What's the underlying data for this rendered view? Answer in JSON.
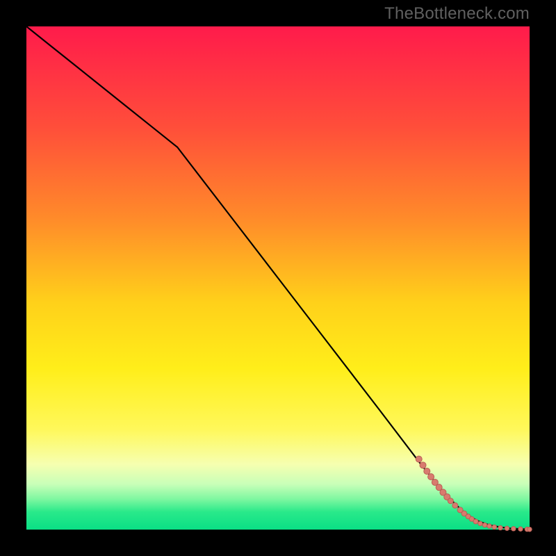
{
  "attribution": "TheBottleneck.com",
  "gradient_stops": [
    {
      "pct": 0,
      "color": "#ff1b4b"
    },
    {
      "pct": 20,
      "color": "#ff4e3a"
    },
    {
      "pct": 38,
      "color": "#ff8a2a"
    },
    {
      "pct": 55,
      "color": "#ffd11a"
    },
    {
      "pct": 68,
      "color": "#ffee1a"
    },
    {
      "pct": 80,
      "color": "#fff85a"
    },
    {
      "pct": 87,
      "color": "#f6ffb0"
    },
    {
      "pct": 91,
      "color": "#c8ffb8"
    },
    {
      "pct": 94,
      "color": "#7cf7a0"
    },
    {
      "pct": 96.5,
      "color": "#29e98a"
    },
    {
      "pct": 100,
      "color": "#0adf85"
    }
  ],
  "styles": {
    "line_color": "#000000",
    "line_width": 2.2,
    "marker_fill": "#d87b6e",
    "marker_stroke": "#ba5f55",
    "marker_stroke_width": 1.0
  },
  "chart_data": {
    "type": "line",
    "title": "",
    "xlabel": "",
    "ylabel": "",
    "xlim": [
      0,
      100
    ],
    "ylim": [
      0,
      100
    ],
    "grid": false,
    "series": [
      {
        "name": "curve",
        "kind": "line",
        "x": [
          0,
          5,
          10,
          15,
          20,
          25,
          30,
          40,
          50,
          60,
          70,
          78,
          82,
          85,
          87,
          88.5,
          90,
          92,
          94,
          96,
          98,
          100
        ],
        "y": [
          100,
          96,
          92,
          88,
          84,
          80,
          76,
          63,
          50,
          37,
          24,
          13.5,
          8.5,
          5.3,
          3.4,
          2.4,
          1.6,
          0.9,
          0.5,
          0.25,
          0.12,
          0.05
        ]
      },
      {
        "name": "markers",
        "kind": "scatter",
        "points": [
          {
            "x": 78.0,
            "y": 14.0,
            "r": 4.5
          },
          {
            "x": 78.8,
            "y": 12.8,
            "r": 4.5
          },
          {
            "x": 79.6,
            "y": 11.6,
            "r": 4.5
          },
          {
            "x": 80.4,
            "y": 10.5,
            "r": 4.5
          },
          {
            "x": 81.2,
            "y": 9.4,
            "r": 4.5
          },
          {
            "x": 82.0,
            "y": 8.4,
            "r": 4.5
          },
          {
            "x": 82.8,
            "y": 7.4,
            "r": 4.5
          },
          {
            "x": 83.6,
            "y": 6.5,
            "r": 4.5
          },
          {
            "x": 84.3,
            "y": 5.7,
            "r": 4.0
          },
          {
            "x": 85.2,
            "y": 4.8,
            "r": 4.0
          },
          {
            "x": 86.2,
            "y": 3.9,
            "r": 4.0
          },
          {
            "x": 87.0,
            "y": 3.2,
            "r": 3.8
          },
          {
            "x": 87.8,
            "y": 2.6,
            "r": 3.5
          },
          {
            "x": 88.5,
            "y": 2.1,
            "r": 3.5
          },
          {
            "x": 89.3,
            "y": 1.6,
            "r": 3.5
          },
          {
            "x": 90.2,
            "y": 1.2,
            "r": 3.2
          },
          {
            "x": 91.1,
            "y": 0.9,
            "r": 3.2
          },
          {
            "x": 92.0,
            "y": 0.7,
            "r": 3.2
          },
          {
            "x": 93.0,
            "y": 0.5,
            "r": 3.2
          },
          {
            "x": 94.2,
            "y": 0.35,
            "r": 3.2
          },
          {
            "x": 95.5,
            "y": 0.25,
            "r": 3.2
          },
          {
            "x": 96.8,
            "y": 0.18,
            "r": 3.2
          },
          {
            "x": 98.2,
            "y": 0.12,
            "r": 3.2
          },
          {
            "x": 99.5,
            "y": 0.07,
            "r": 3.2
          },
          {
            "x": 100.0,
            "y": 0.05,
            "r": 3.2
          }
        ]
      }
    ]
  }
}
